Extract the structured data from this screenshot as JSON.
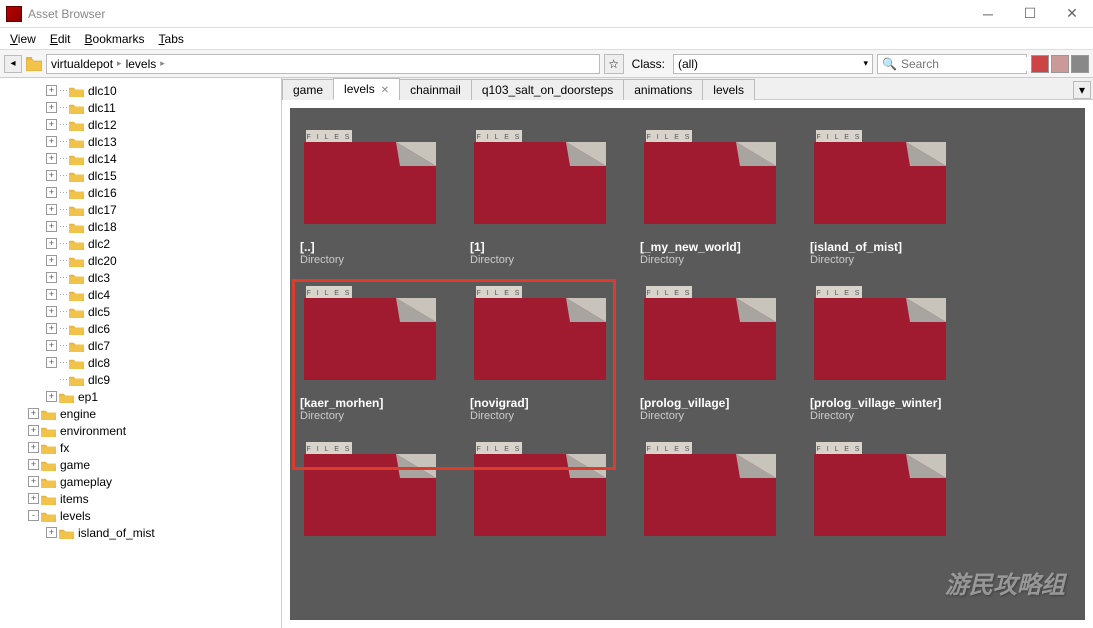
{
  "window": {
    "title": "Asset Browser"
  },
  "menubar": {
    "items": [
      "View",
      "Edit",
      "Bookmarks",
      "Tabs"
    ]
  },
  "toolbar": {
    "breadcrumb": [
      "virtualdepot",
      "levels"
    ],
    "class_label": "Class:",
    "class_value": "(all)",
    "search_placeholder": "Search"
  },
  "tree": {
    "items": [
      {
        "label": "dlc10",
        "depth": 2,
        "exp": "+",
        "dots": true
      },
      {
        "label": "dlc11",
        "depth": 2,
        "exp": "+",
        "dots": true
      },
      {
        "label": "dlc12",
        "depth": 2,
        "exp": "+",
        "dots": true
      },
      {
        "label": "dlc13",
        "depth": 2,
        "exp": "+",
        "dots": true
      },
      {
        "label": "dlc14",
        "depth": 2,
        "exp": "+",
        "dots": true
      },
      {
        "label": "dlc15",
        "depth": 2,
        "exp": "+",
        "dots": true
      },
      {
        "label": "dlc16",
        "depth": 2,
        "exp": "+",
        "dots": true
      },
      {
        "label": "dlc17",
        "depth": 2,
        "exp": "+",
        "dots": true
      },
      {
        "label": "dlc18",
        "depth": 2,
        "exp": "+",
        "dots": true
      },
      {
        "label": "dlc2",
        "depth": 2,
        "exp": "+",
        "dots": true
      },
      {
        "label": "dlc20",
        "depth": 2,
        "exp": "+",
        "dots": true
      },
      {
        "label": "dlc3",
        "depth": 2,
        "exp": "+",
        "dots": true
      },
      {
        "label": "dlc4",
        "depth": 2,
        "exp": "+",
        "dots": true
      },
      {
        "label": "dlc5",
        "depth": 2,
        "exp": "+",
        "dots": true
      },
      {
        "label": "dlc6",
        "depth": 2,
        "exp": "+",
        "dots": true
      },
      {
        "label": "dlc7",
        "depth": 2,
        "exp": "+",
        "dots": true
      },
      {
        "label": "dlc8",
        "depth": 2,
        "exp": "+",
        "dots": true
      },
      {
        "label": "dlc9",
        "depth": 2,
        "exp": "",
        "dots": true
      },
      {
        "label": "ep1",
        "depth": 2,
        "exp": "+",
        "dots": false
      },
      {
        "label": "engine",
        "depth": 1,
        "exp": "+",
        "dots": false
      },
      {
        "label": "environment",
        "depth": 1,
        "exp": "+",
        "dots": false
      },
      {
        "label": "fx",
        "depth": 1,
        "exp": "+",
        "dots": false
      },
      {
        "label": "game",
        "depth": 1,
        "exp": "+",
        "dots": false
      },
      {
        "label": "gameplay",
        "depth": 1,
        "exp": "+",
        "dots": false
      },
      {
        "label": "items",
        "depth": 1,
        "exp": "+",
        "dots": false
      },
      {
        "label": "levels",
        "depth": 1,
        "exp": "-",
        "dots": false,
        "sel": false
      },
      {
        "label": "island_of_mist",
        "depth": 2,
        "exp": "+",
        "dots": false,
        "cut": true
      }
    ]
  },
  "tabs": {
    "items": [
      {
        "label": "game",
        "active": false
      },
      {
        "label": "levels",
        "active": true,
        "closable": true
      },
      {
        "label": "chainmail",
        "active": false
      },
      {
        "label": "q103_salt_on_doorsteps",
        "active": false
      },
      {
        "label": "animations",
        "active": false
      },
      {
        "label": "levels",
        "active": false
      }
    ]
  },
  "grid": {
    "folder_tab_label": "F I L E S",
    "type_label": "Directory",
    "items": [
      {
        "name": "[..]"
      },
      {
        "name": "[1]"
      },
      {
        "name": "[_my_new_world]"
      },
      {
        "name": "[island_of_mist]"
      },
      {
        "name": "[kaer_morhen]"
      },
      {
        "name": "[novigrad]"
      },
      {
        "name": "[prolog_village]"
      },
      {
        "name": "[prolog_village_winter]"
      },
      {
        "name": ""
      },
      {
        "name": ""
      },
      {
        "name": ""
      },
      {
        "name": ""
      }
    ],
    "highlight": {
      "row": 1,
      "col_start": 0,
      "col_end": 1
    }
  },
  "watermark": "游民攻略组"
}
